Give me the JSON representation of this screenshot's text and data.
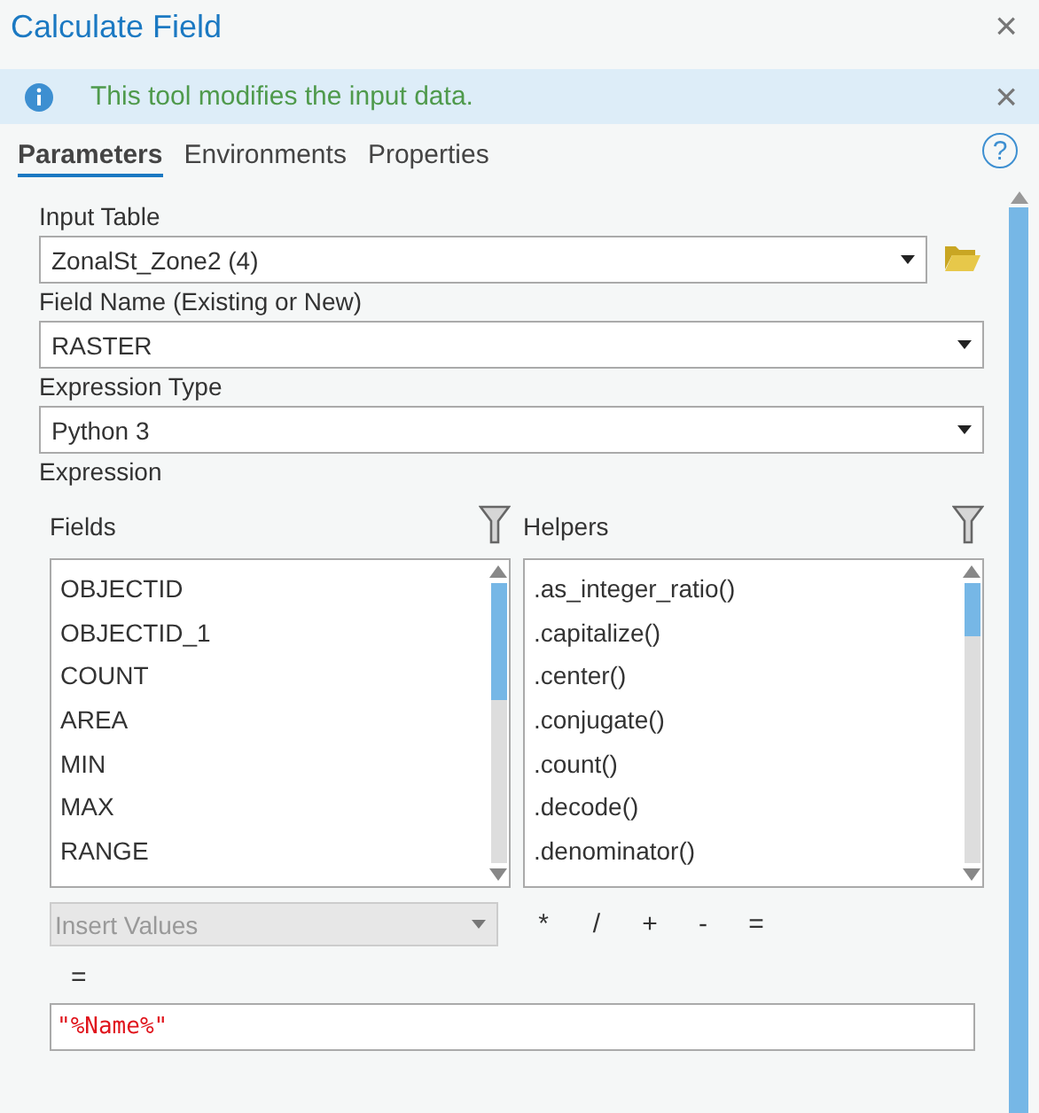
{
  "window": {
    "title": "Calculate Field",
    "close": "×"
  },
  "notice": {
    "text": "This tool modifies the input data.",
    "close": "×"
  },
  "tabs": [
    {
      "label": "Parameters",
      "selected": true
    },
    {
      "label": "Environments",
      "selected": false
    },
    {
      "label": "Properties",
      "selected": false
    }
  ],
  "help": "?",
  "parameters": [
    {
      "label": "Input Table",
      "value": "ZonalSt_Zone2 (4)",
      "browse": true
    },
    {
      "label": "Field Name (Existing or New)",
      "value": "RASTER",
      "browse": false
    },
    {
      "label": "Expression Type",
      "value": "Python 3",
      "browse": false
    }
  ],
  "expression": {
    "label": "Expression",
    "fields": {
      "label": "Fields",
      "items": [
        "OBJECTID",
        "OBJECTID_1",
        "COUNT",
        "AREA",
        "MIN",
        "MAX",
        "RANGE"
      ]
    },
    "helpers": {
      "label": "Helpers",
      "items": [
        ".as_integer_ratio()",
        ".capitalize()",
        ".center()",
        ".conjugate()",
        ".count()",
        ".decode()",
        ".denominator()"
      ]
    },
    "insert_values": {
      "placeholder": "Insert Values",
      "disabled": true
    },
    "operators": [
      "*",
      "/",
      "+",
      "-",
      "="
    ],
    "target": "=",
    "value": "\"%Name%\""
  }
}
